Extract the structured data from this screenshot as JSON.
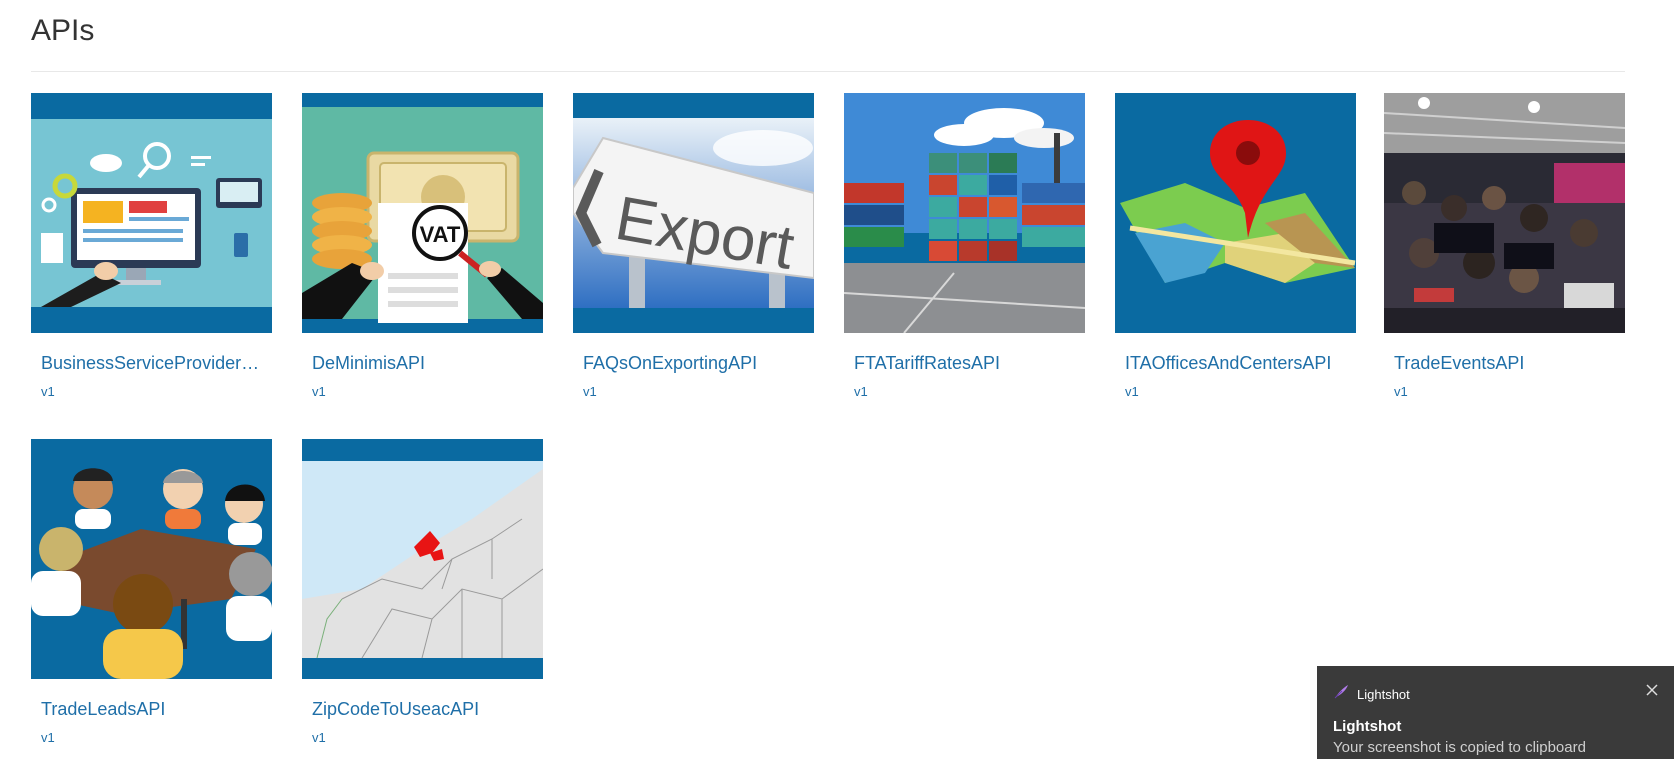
{
  "page": {
    "title": "APIs"
  },
  "apis": [
    {
      "name": "BusinessServiceProvider…",
      "version": "v1",
      "icon": "business-services-illustration"
    },
    {
      "name": "DeMinimisAPI",
      "version": "v1",
      "icon": "vat-illustration"
    },
    {
      "name": "FAQsOnExportingAPI",
      "version": "v1",
      "icon": "export-sign-photo"
    },
    {
      "name": "FTATariffRatesAPI",
      "version": "v1",
      "icon": "shipping-containers-photo"
    },
    {
      "name": "ITAOfficesAndCentersAPI",
      "version": "v1",
      "icon": "map-pin-illustration"
    },
    {
      "name": "TradeEventsAPI",
      "version": "v1",
      "icon": "trade-event-crowd-photo"
    },
    {
      "name": "TradeLeadsAPI",
      "version": "v1",
      "icon": "meeting-table-illustration"
    },
    {
      "name": "ZipCodeToUseacAPI",
      "version": "v1",
      "icon": "zip-code-map-illustration"
    }
  ],
  "thumb_text": {
    "vat": "VAT",
    "export": "Export"
  },
  "toast": {
    "app_name": "Lightshot",
    "title": "Lightshot",
    "message": "Your screenshot is copied to clipboard"
  },
  "colors": {
    "link": "#1f6fa8",
    "thumb_band": "#0a6aa1",
    "toast_bg": "#3a3a3a"
  }
}
